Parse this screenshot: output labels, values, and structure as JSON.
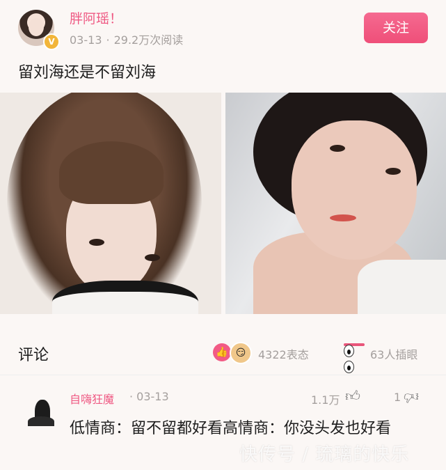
{
  "author": {
    "name": "胖阿瑶！",
    "date": "03-13",
    "separator": "·",
    "reads": "29.2万次阅读"
  },
  "follow_label": "关注",
  "post_title": "留刘海还是不留刘海",
  "comments": {
    "title": "评论",
    "reaction_count": "4322表态",
    "eyes_count": "63人插眼"
  },
  "comment": {
    "user": "自嗨狂魔",
    "date": "· 03-13",
    "likes": "1.1万",
    "dislikes": "1",
    "text": "低情商：留不留都好看高情商：你没头发也好看"
  },
  "watermark": "快传号 / 琉璃的快乐",
  "icons": [
    "verified-badge-icon",
    "like-reaction-icon",
    "emoji-reaction-icon",
    "eyes-icon",
    "thumb-up-icon",
    "thumb-down-icon"
  ],
  "colors": {
    "accent": "#ef5a84",
    "follow_button": "#f0577f",
    "meta_gray": "#a49f9d"
  }
}
